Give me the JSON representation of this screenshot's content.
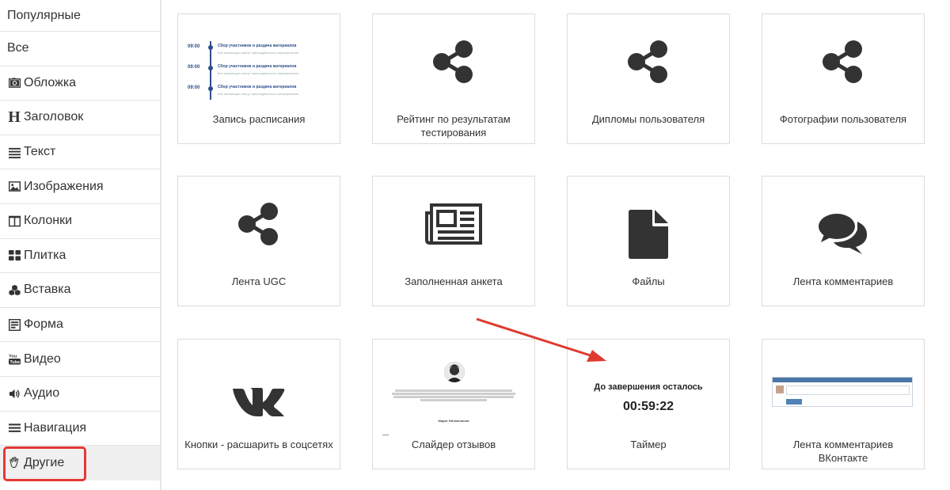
{
  "sidebar": {
    "items": [
      {
        "label": "Популярные",
        "icon": ""
      },
      {
        "label": "Все",
        "icon": ""
      },
      {
        "label": "Обложка",
        "icon": "camera-icon"
      },
      {
        "label": "Заголовок",
        "icon": "heading-icon"
      },
      {
        "label": "Текст",
        "icon": "align-justify-icon"
      },
      {
        "label": "Изображения",
        "icon": "image-icon"
      },
      {
        "label": "Колонки",
        "icon": "columns-icon"
      },
      {
        "label": "Плитка",
        "icon": "tiles-icon"
      },
      {
        "label": "Вставка",
        "icon": "cubes-icon"
      },
      {
        "label": "Форма",
        "icon": "form-icon"
      },
      {
        "label": "Видео",
        "icon": "youtube-icon"
      },
      {
        "label": "Аудио",
        "icon": "volume-icon"
      },
      {
        "label": "Навигация",
        "icon": "bars-icon"
      },
      {
        "label": "Другие",
        "icon": "hand-icon"
      }
    ],
    "active_index": 13
  },
  "cards": [
    {
      "label": "Запись расписания",
      "visual": "schedule-preview"
    },
    {
      "label": "Рейтинг по результатам тестирования",
      "visual": "share-icon"
    },
    {
      "label": "Дипломы пользователя",
      "visual": "share-icon"
    },
    {
      "label": "Фотографии пользователя",
      "visual": "share-icon"
    },
    {
      "label": "Лента UGC",
      "visual": "share-icon"
    },
    {
      "label": "Заполненная анкета",
      "visual": "newspaper-icon"
    },
    {
      "label": "Файлы",
      "visual": "file-icon"
    },
    {
      "label": "Лента комментариев",
      "visual": "comments-icon"
    },
    {
      "label": "Кнопки - расшарить в соцсетях",
      "visual": "vk-icon"
    },
    {
      "label": "Слайдер отзывов",
      "visual": "reviews-preview"
    },
    {
      "label": "Таймер",
      "visual": "timer-preview"
    },
    {
      "label": "Лента комментариев ВКонтакте",
      "visual": "vk-comments-preview"
    }
  ],
  "schedule_preview": {
    "rows": [
      {
        "time": "09:00",
        "title": "Сбор участников и раздача материалов",
        "sub": "Все желающие смогут присоединиться к мероприятию"
      },
      {
        "time": "09:00",
        "title": "Сбор участников и раздача материалов",
        "sub": "Все желающие смогут присоединиться к мероприятию"
      },
      {
        "time": "09:00",
        "title": "Сбор участников и раздача материалов",
        "sub": "Все желающие смогут присоединиться к мероприятию"
      }
    ]
  },
  "timer_preview": {
    "title": "До завершения осталось",
    "value": "00:59:22"
  },
  "reviews_preview": {
    "name": "Марат Нигматзянов"
  },
  "colors": {
    "icon": "#333333",
    "highlight": "#e53935",
    "arrow": "#e03a2f",
    "accent": "#2d4f8a"
  }
}
